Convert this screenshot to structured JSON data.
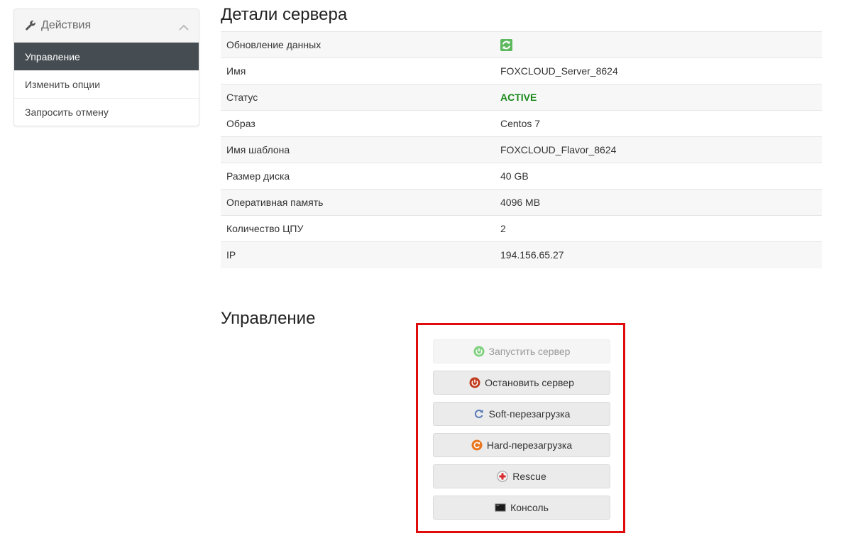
{
  "sidebar": {
    "title": "Действия",
    "items": [
      {
        "label": "Управление",
        "active": true
      },
      {
        "label": "Изменить опции",
        "active": false
      },
      {
        "label": "Запросить отмену",
        "active": false
      }
    ]
  },
  "details": {
    "title": "Детали сервера",
    "rows": [
      {
        "label": "Обновление данных",
        "value": ""
      },
      {
        "label": "Имя",
        "value": "FOXCLOUD_Server_8624"
      },
      {
        "label": "Статус",
        "value": "ACTIVE"
      },
      {
        "label": "Образ",
        "value": "Centos 7"
      },
      {
        "label": "Имя шаблона",
        "value": "FOXCLOUD_Flavor_8624"
      },
      {
        "label": "Размер диска",
        "value": "40 GB"
      },
      {
        "label": "Оперативная память",
        "value": "4096 MB"
      },
      {
        "label": "Количество ЦПУ",
        "value": "2"
      },
      {
        "label": "IP",
        "value": "194.156.65.27"
      }
    ]
  },
  "management": {
    "title": "Управление",
    "buttons": [
      {
        "label": "Запустить сервер",
        "icon": "power-on-icon",
        "disabled": true
      },
      {
        "label": "Остановить сервер",
        "icon": "power-off-icon",
        "disabled": false
      },
      {
        "label": "Soft-перезагрузка",
        "icon": "soft-reboot-icon",
        "disabled": false
      },
      {
        "label": "Hard-перезагрузка",
        "icon": "hard-reboot-icon",
        "disabled": false
      },
      {
        "label": "Rescue",
        "icon": "rescue-icon",
        "disabled": false
      },
      {
        "label": "Консоль",
        "icon": "console-icon",
        "disabled": false
      }
    ]
  },
  "colors": {
    "active_status": "#1d8a1d",
    "sidebar_active_bg": "#464d52",
    "highlight_border": "#e00b0b"
  }
}
